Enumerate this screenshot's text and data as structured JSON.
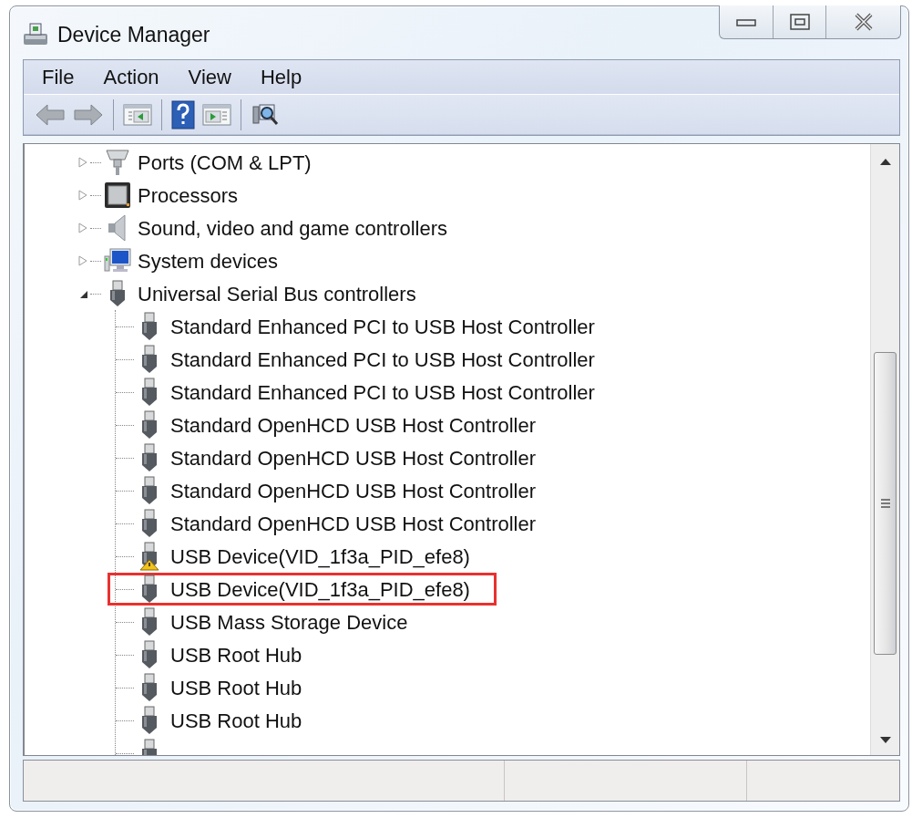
{
  "window": {
    "title": "Device Manager"
  },
  "menu": [
    "File",
    "Action",
    "View",
    "Help"
  ],
  "toolbar": [
    {
      "kind": "back"
    },
    {
      "kind": "forward"
    },
    {
      "kind": "separator"
    },
    {
      "kind": "console-tree"
    },
    {
      "kind": "separator"
    },
    {
      "kind": "help"
    },
    {
      "kind": "action-pane"
    },
    {
      "kind": "separator"
    },
    {
      "kind": "scan"
    }
  ],
  "tree": [
    {
      "label": "Ports (COM & LPT)",
      "kind": "port",
      "expanded": false
    },
    {
      "label": "Processors",
      "kind": "processor",
      "expanded": false
    },
    {
      "label": "Sound, video and game controllers",
      "kind": "sound",
      "expanded": false
    },
    {
      "label": "System devices",
      "kind": "system",
      "expanded": false
    },
    {
      "label": "Universal Serial Bus controllers",
      "kind": "usb",
      "expanded": true,
      "children": [
        {
          "label": "Standard Enhanced PCI to USB Host Controller",
          "warning": false,
          "annotated": false
        },
        {
          "label": "Standard Enhanced PCI to USB Host Controller",
          "warning": false,
          "annotated": false
        },
        {
          "label": "Standard Enhanced PCI to USB Host Controller",
          "warning": false,
          "annotated": false
        },
        {
          "label": "Standard OpenHCD USB Host Controller",
          "warning": false,
          "annotated": false
        },
        {
          "label": "Standard OpenHCD USB Host Controller",
          "warning": false,
          "annotated": false
        },
        {
          "label": "Standard OpenHCD USB Host Controller",
          "warning": false,
          "annotated": false
        },
        {
          "label": "Standard OpenHCD USB Host Controller",
          "warning": false,
          "annotated": false
        },
        {
          "label": "USB Device(VID_1f3a_PID_efe8)",
          "warning": true,
          "annotated": false
        },
        {
          "label": "USB Device(VID_1f3a_PID_efe8)",
          "warning": false,
          "annotated": true
        },
        {
          "label": "USB Mass Storage Device",
          "warning": false,
          "annotated": false
        },
        {
          "label": "USB Root Hub",
          "warning": false,
          "annotated": false
        },
        {
          "label": "USB Root Hub",
          "warning": false,
          "annotated": false
        },
        {
          "label": "USB Root Hub",
          "warning": false,
          "annotated": false
        },
        {
          "warning": false,
          "annotated": false
        }
      ]
    }
  ]
}
